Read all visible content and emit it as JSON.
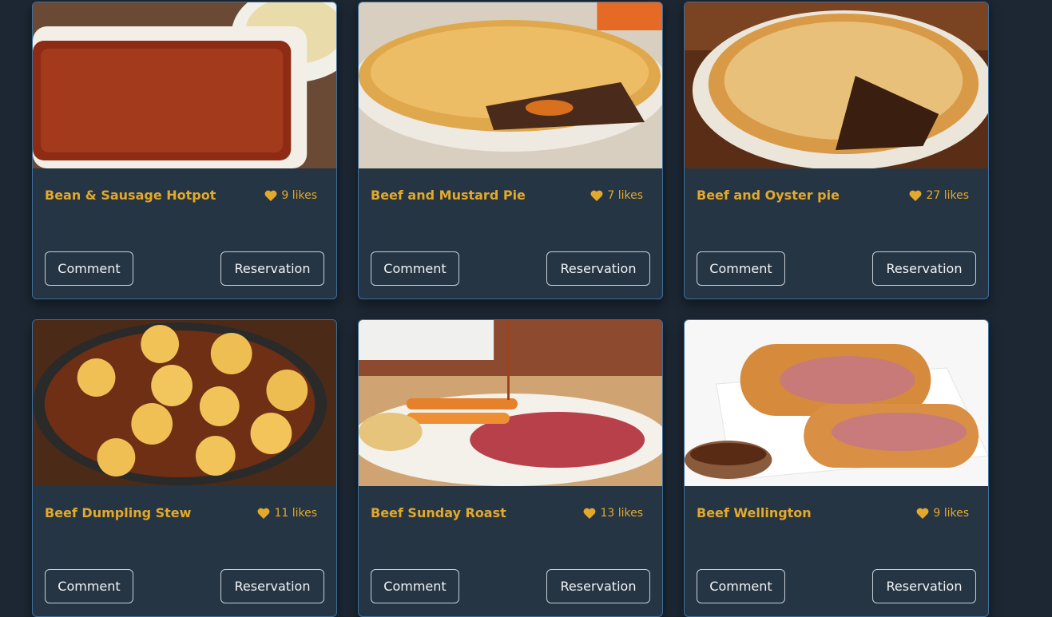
{
  "cards": [
    {
      "title": "Bean & Sausage Hotpot",
      "likes": "9 likes",
      "comment": "Comment",
      "reserve": "Reservation"
    },
    {
      "title": "Beef and Mustard Pie",
      "likes": "7 likes",
      "comment": "Comment",
      "reserve": "Reservation"
    },
    {
      "title": "Beef and Oyster pie",
      "likes": "27 likes",
      "comment": "Comment",
      "reserve": "Reservation"
    },
    {
      "title": "Beef Dumpling Stew",
      "likes": "11 likes",
      "comment": "Comment",
      "reserve": "Reservation"
    },
    {
      "title": "Beef Sunday Roast",
      "likes": "13 likes",
      "comment": "Comment",
      "reserve": "Reservation"
    },
    {
      "title": "Beef Wellington",
      "likes": "9 likes",
      "comment": "Comment",
      "reserve": "Reservation"
    }
  ],
  "icons": {
    "like": "heart-icon"
  },
  "colors": {
    "accent": "#e3a92a",
    "card": "#263544",
    "background": "#1c2733",
    "border": "#3f6f9a"
  }
}
